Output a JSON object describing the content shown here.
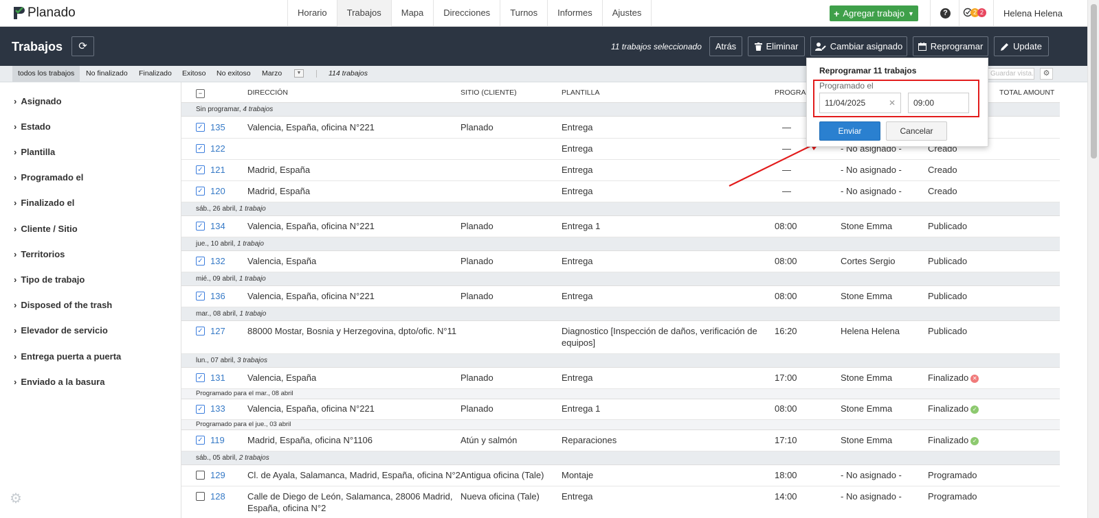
{
  "app": {
    "name": "Planado",
    "user": "Helena Helena",
    "notif_1": "2",
    "notif_2": "2",
    "help": "?"
  },
  "nav": [
    {
      "label": "Horario"
    },
    {
      "label": "Trabajos"
    },
    {
      "label": "Mapa"
    },
    {
      "label": "Direcciones"
    },
    {
      "label": "Turnos"
    },
    {
      "label": "Informes"
    },
    {
      "label": "Ajustes"
    }
  ],
  "add_job": {
    "label": "Agregar trabajo"
  },
  "header": {
    "title": "Trabajos",
    "selected_text": "11 trabajos seleccionado",
    "back": "Atrás",
    "delete": "Eliminar",
    "change_assignee": "Cambiar asignado",
    "reschedule": "Reprogramar",
    "update": "Update"
  },
  "filters": {
    "items": [
      "todos los trabajos",
      "No finalizado",
      "Finalizado",
      "Exitoso",
      "No exitoso",
      "Marzo"
    ],
    "count": "114 trabajos",
    "search_placeholder": "Guardar vista..."
  },
  "sidebar": [
    "Asignado",
    "Estado",
    "Plantilla",
    "Programado el",
    "Finalizado el",
    "Cliente / Sitio",
    "Territorios",
    "Tipo de trabajo",
    "Disposed of the trash",
    "Elevador de servicio",
    "Entrega puerta a puerta",
    "Enviado a la basura"
  ],
  "columns": {
    "address": "DIRECCIÓN",
    "site": "SITIO (CLIENTE)",
    "template": "PLANTILLA",
    "scheduled": "PROGRAM",
    "total": "TOTAL AMOUNT"
  },
  "groups": [
    {
      "date": "Sin programar,",
      "count": "4 trabajos"
    },
    {
      "date": "sáb., 26 abril,",
      "count": "1 trabajo"
    },
    {
      "date": "jue., 10 abril,",
      "count": "1 trabajo"
    },
    {
      "date": "mié., 09 abril,",
      "count": "1 trabajo"
    },
    {
      "date": "mar., 08 abril,",
      "count": "1 trabajo"
    },
    {
      "date": "lun., 07 abril,",
      "count": "3 trabajos"
    },
    {
      "date": "sáb., 05 abril,",
      "count": "2 trabajos"
    }
  ],
  "subnotes": [
    "Programado para el mar., 08 abril",
    "Programado para el jue., 03 abril"
  ],
  "rows": [
    {
      "id": "135",
      "address": "Valencia, España, oficina N°221",
      "site": "Planado",
      "template": "Entrega",
      "time": "—",
      "assignee": "",
      "status": "",
      "checked": true
    },
    {
      "id": "122",
      "address": "",
      "site": "",
      "template": "Entrega",
      "time": "—",
      "assignee": "- No asignado -",
      "status": "Creado",
      "checked": true
    },
    {
      "id": "121",
      "address": "Madrid, España",
      "site": "",
      "template": "Entrega",
      "time": "—",
      "assignee": "- No asignado -",
      "status": "Creado",
      "checked": true
    },
    {
      "id": "120",
      "address": "Madrid, España",
      "site": "",
      "template": "Entrega",
      "time": "—",
      "assignee": "- No asignado -",
      "status": "Creado",
      "checked": true
    },
    {
      "id": "134",
      "address": "Valencia, España, oficina N°221",
      "site": "Planado",
      "template": "Entrega 1",
      "time": "08:00",
      "assignee": "Stone Emma",
      "status": "Publicado",
      "checked": true
    },
    {
      "id": "132",
      "address": "Valencia, España",
      "site": "Planado",
      "template": "Entrega",
      "time": "08:00",
      "assignee": "Cortes Sergio",
      "status": "Publicado",
      "checked": true
    },
    {
      "id": "136",
      "address": "Valencia, España, oficina N°221",
      "site": "Planado",
      "template": "Entrega",
      "time": "08:00",
      "assignee": "Stone Emma",
      "status": "Publicado",
      "checked": true
    },
    {
      "id": "127",
      "address": "88000 Mostar, Bosnia y Herzegovina, dpto/ofic. N°11",
      "site": "",
      "template": "Diagnostico [Inspección de daños, verificación de",
      "template2": "equipos]",
      "time": "16:20",
      "assignee": "Helena Helena",
      "status": "Publicado",
      "checked": true
    },
    {
      "id": "131",
      "address": "Valencia, España",
      "site": "Planado",
      "template": "Entrega",
      "time": "17:00",
      "assignee": "Stone Emma",
      "status": "Finalizado",
      "checked": true,
      "dot": "fail"
    },
    {
      "id": "133",
      "address": "Valencia, España, oficina N°221",
      "site": "Planado",
      "template": "Entrega 1",
      "time": "08:00",
      "assignee": "Stone Emma",
      "status": "Finalizado",
      "checked": true,
      "dot": "ok"
    },
    {
      "id": "119",
      "address": "Madrid, España, oficina N°1106",
      "site": "Atún y salmón",
      "template": "Reparaciones",
      "time": "17:10",
      "assignee": "Stone Emma",
      "status": "Finalizado",
      "checked": true,
      "dot": "ok"
    },
    {
      "id": "129",
      "address": "Cl. de Ayala, Salamanca, Madrid, España, oficina N°2",
      "site": "Antigua oficina (Tale)",
      "template": "Montaje",
      "time": "18:00",
      "assignee": "- No asignado -",
      "status": "Programado",
      "checked": false
    },
    {
      "id": "128",
      "address": "Calle de Diego de León, Salamanca, 28006 Madrid,",
      "address2": "España, oficina N°2",
      "site": "Nueva oficina (Tale)",
      "template": "Entrega",
      "time": "14:00",
      "assignee": "- No asignado -",
      "status": "Programado",
      "checked": false
    }
  ],
  "popup": {
    "title": "Reprogramar 11 trabajos",
    "label": "Programado el",
    "date": "11/04/2025",
    "time": "09:00",
    "send": "Enviar",
    "cancel": "Cancelar"
  },
  "colors": {
    "header_bg": "#2c3542",
    "accent": "#2a80d0",
    "add_btn": "#3fa04a",
    "annotation": "#e21b1b",
    "ok": "#8dc96f",
    "fail": "#f07a7a",
    "notif_1": "#f5a623",
    "notif_2": "#e8475f"
  }
}
